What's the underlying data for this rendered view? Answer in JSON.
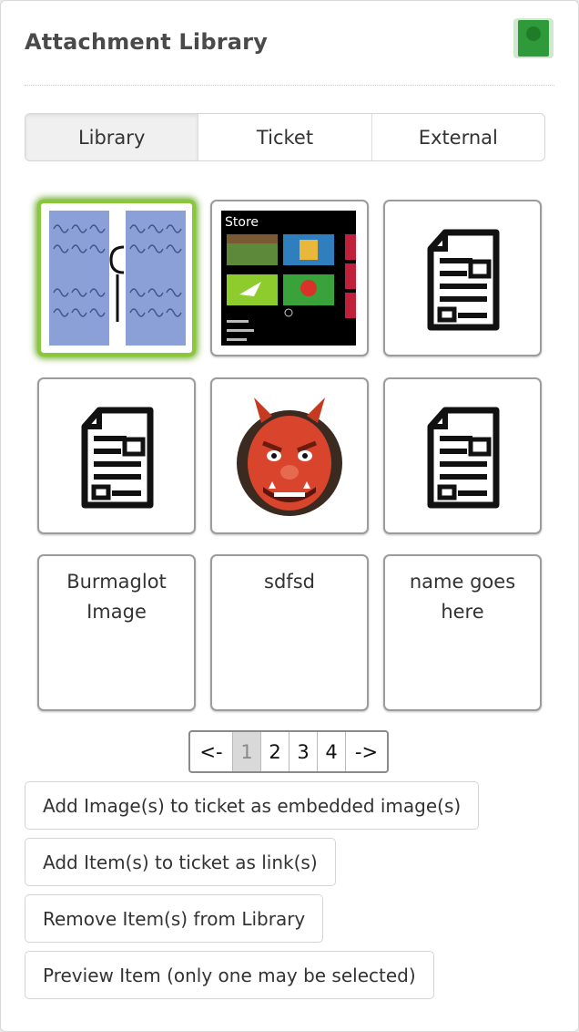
{
  "header": {
    "title": "Attachment Library",
    "app_icon": "library-book-icon"
  },
  "tabs": [
    {
      "label": "Library",
      "active": true
    },
    {
      "label": "Ticket",
      "active": false
    },
    {
      "label": "External",
      "active": false
    }
  ],
  "tiles": [
    {
      "kind": "image",
      "name": "burmese-script-image-thumbnail",
      "selected": true
    },
    {
      "kind": "image",
      "name": "store-screenshot-thumbnail",
      "selected": false,
      "store_title": "Store"
    },
    {
      "kind": "document",
      "name": "document-icon",
      "selected": false
    },
    {
      "kind": "document",
      "name": "document-icon",
      "selected": false
    },
    {
      "kind": "image",
      "name": "ogre-mask-emoji-thumbnail",
      "selected": false
    },
    {
      "kind": "document",
      "name": "document-icon",
      "selected": false
    },
    {
      "kind": "text",
      "label": "Burmaglot Image",
      "selected": false
    },
    {
      "kind": "text",
      "label": "sdfsd",
      "selected": false
    },
    {
      "kind": "text",
      "label": "name goes here",
      "selected": false
    }
  ],
  "pagination": {
    "prev_label": "<-",
    "next_label": "->",
    "pages": [
      "1",
      "2",
      "3",
      "4"
    ],
    "current_page": "1"
  },
  "actions": {
    "embed_label": "Add Image(s) to ticket as embedded image(s)",
    "link_label": "Add Item(s) to ticket as link(s)",
    "remove_label": "Remove Item(s) from Library",
    "preview_label": "Preview Item (only one may be selected)"
  },
  "colors": {
    "selected_border": "#8ac83a",
    "tile_border": "#9c9c9c",
    "active_tab_bg": "#f0f0f0"
  }
}
